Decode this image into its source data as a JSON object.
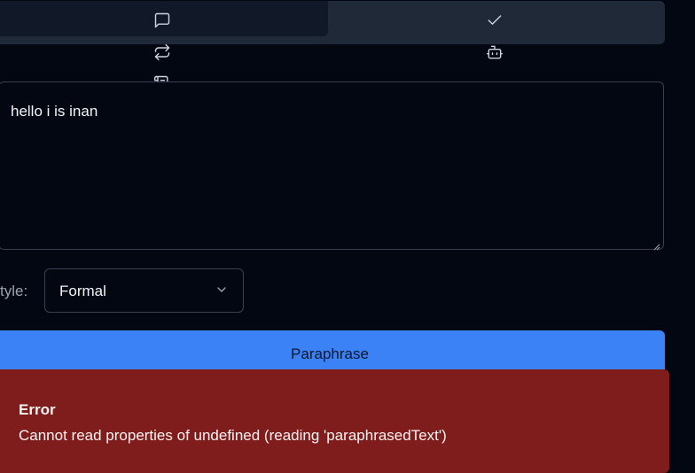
{
  "tabs": {
    "icons": [
      "message-square-icon",
      "repeat-icon",
      "scroll-icon",
      "check-icon",
      "bot-icon"
    ]
  },
  "editor": {
    "value": "hello i is inan"
  },
  "style_selector": {
    "label": "tyle:",
    "selected": "Formal"
  },
  "actions": {
    "paraphrase_label": "Paraphrase"
  },
  "error": {
    "title": "Error",
    "message": "Cannot read properties of undefined (reading 'paraphrasedText')"
  },
  "colors": {
    "background": "#030712",
    "accent": "#3b82f6",
    "error": "#7f1d1d"
  }
}
